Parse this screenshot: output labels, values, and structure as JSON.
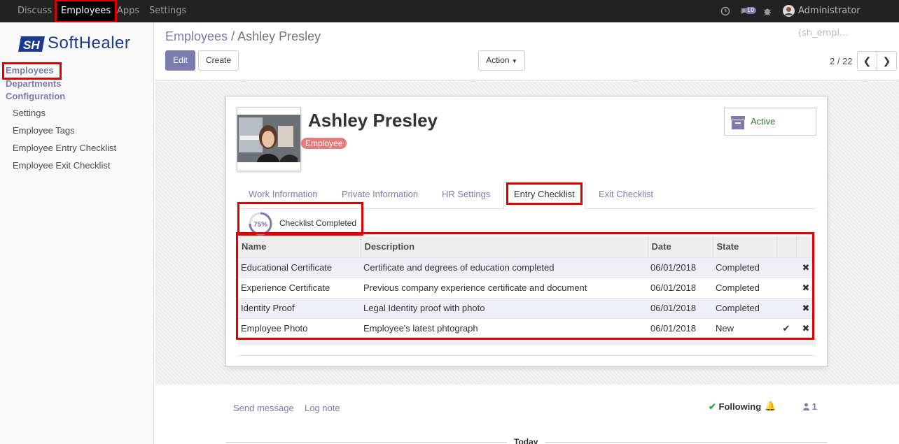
{
  "navbar": {
    "items": [
      "Discuss",
      "Employees",
      "Apps",
      "Settings"
    ],
    "notifications_count": "10",
    "user": "Administrator (sh_empl..."
  },
  "sidebar": {
    "brand": "SoftHealer",
    "headers": [
      "Employees",
      "Departments",
      "Configuration"
    ],
    "items": [
      "Settings",
      "Employee Tags",
      "Employee Entry Checklist",
      "Employee Exit Checklist"
    ]
  },
  "control": {
    "breadcrumb_parent": "Employees",
    "breadcrumb_sep": "/",
    "breadcrumb_current": "Ashley Presley",
    "edit_label": "Edit",
    "create_label": "Create",
    "action_label": "Action",
    "pager": "2 / 22"
  },
  "employee": {
    "name": "Ashley Presley",
    "tag": "Employee",
    "status": "Active"
  },
  "tabs": [
    "Work Information",
    "Private Information",
    "HR Settings",
    "Entry Checklist",
    "Exit Checklist"
  ],
  "checklist": {
    "progress_percent": 75,
    "progress_text": "75%",
    "label": "Checklist Completed",
    "columns": [
      "Name",
      "Description",
      "Date",
      "State"
    ],
    "rows": [
      {
        "name": "Educational Certificate",
        "description": "Certificate and degrees of education completed",
        "date": "06/01/2018",
        "state": "Completed"
      },
      {
        "name": "Experience Certificate",
        "description": "Previous company experience certificate and document",
        "date": "06/01/2018",
        "state": "Completed"
      },
      {
        "name": "Identity Proof",
        "description": "Legal Identity proof with photo",
        "date": "06/01/2018",
        "state": "Completed"
      },
      {
        "name": "Employee Photo",
        "description": "Employee's latest phtograph",
        "date": "06/01/2018",
        "state": "New"
      }
    ]
  },
  "chatter": {
    "send_message": "Send message",
    "log_note": "Log note",
    "following": "Following",
    "followers_count": "1",
    "today": "Today"
  },
  "colors": {
    "accent": "#7c7bad",
    "highlight_box": "#e00000",
    "tag": "#e57b7b",
    "active_green": "#2e7d32"
  }
}
